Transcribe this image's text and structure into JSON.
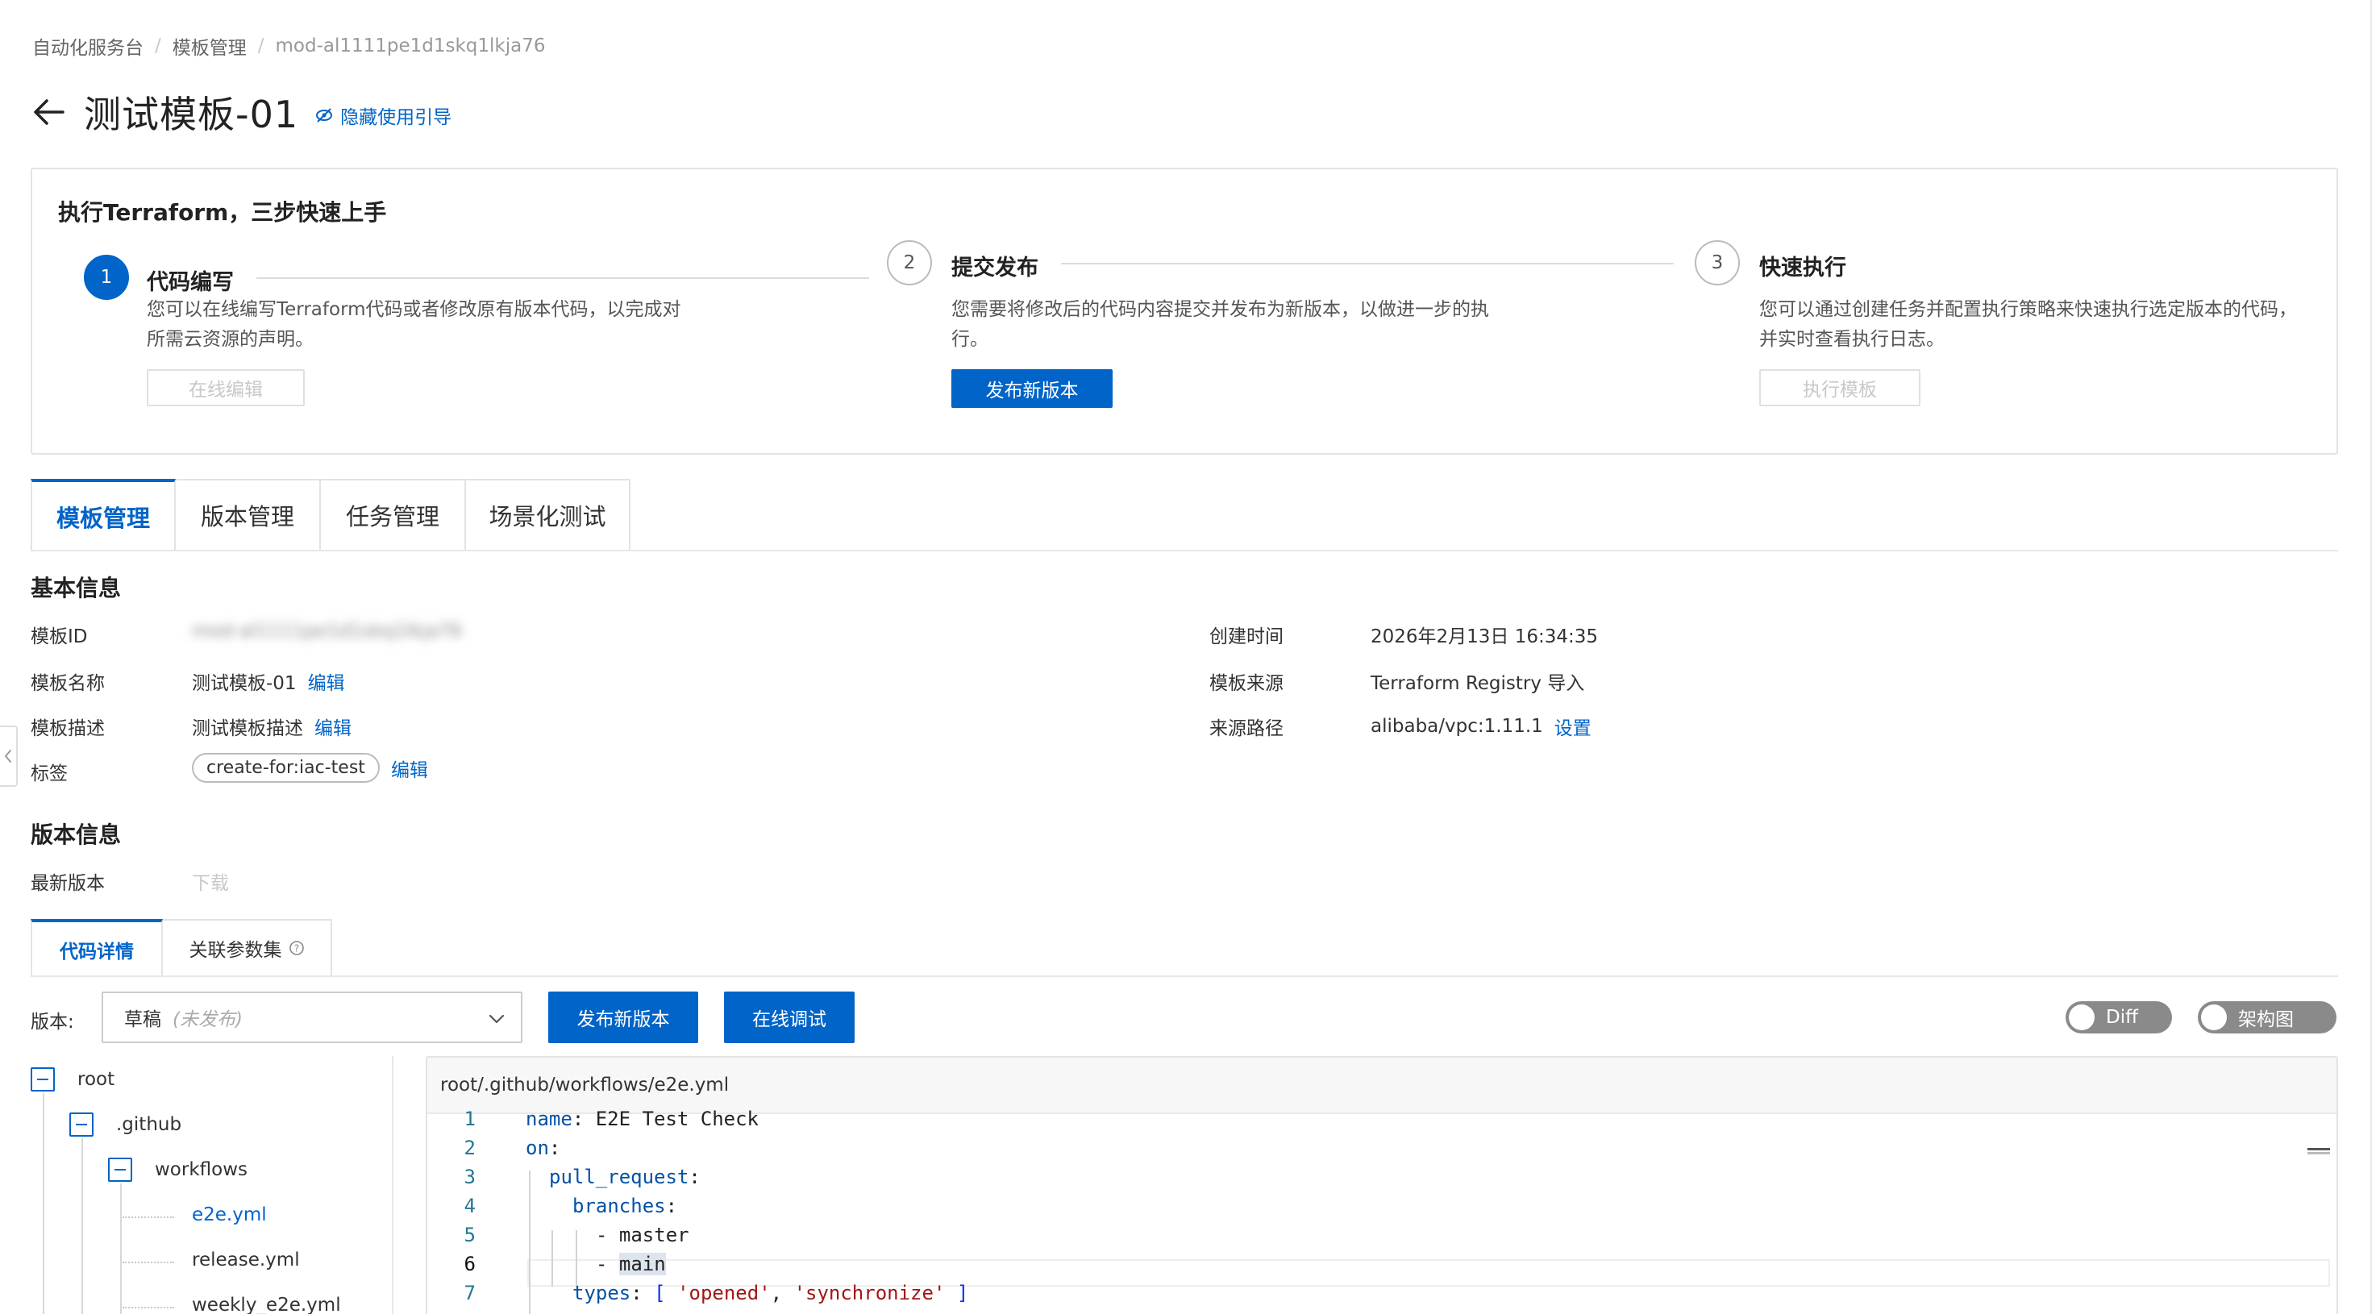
{
  "breadcrumb": {
    "items": [
      "自动化服务台",
      "模板管理",
      "mod-al1111pe1d1skq1lkja76"
    ],
    "separator": "/"
  },
  "header": {
    "title": "测试模板-01",
    "guide_link": "隐藏使用引导"
  },
  "guide": {
    "heading": "执行Terraform，三步快速上手",
    "steps": [
      {
        "number": "1",
        "title": "代码编写",
        "desc": "您可以在线编写Terraform代码或者修改原有版本代码，以完成对所需云资源的声明。",
        "button": "在线编辑"
      },
      {
        "number": "2",
        "title": "提交发布",
        "desc": "您需要将修改后的代码内容提交并发布为新版本，以做进一步的执行。",
        "button": "发布新版本"
      },
      {
        "number": "3",
        "title": "快速执行",
        "desc": "您可以通过创建任务并配置执行策略来快速执行选定版本的代码，并实时查看执行日志。",
        "button": "执行模板"
      }
    ]
  },
  "tabs": [
    "模板管理",
    "版本管理",
    "任务管理",
    "场景化测试"
  ],
  "basic_info": {
    "title": "基本信息",
    "template_id_label": "模板ID",
    "template_id_value": "mod-al1111pe1d1skq1lkja76",
    "name_label": "模板名称",
    "name_value": "测试模板-01",
    "desc_label": "模板描述",
    "desc_value": "测试模板描述",
    "tags_label": "标签",
    "tag_value": "create-for:iac-test",
    "edit": "编辑",
    "created_label": "创建时间",
    "created_value": "2026年2月13日 16:34:35",
    "source_label": "模板来源",
    "source_value": "Terraform Registry 导入",
    "path_label": "来源路径",
    "path_value": "alibaba/vpc:1.11.1",
    "set": "设置"
  },
  "version_info": {
    "title": "版本信息",
    "latest_label": "最新版本",
    "download": "下载"
  },
  "code_tabs": [
    "代码详情",
    "关联参数集"
  ],
  "toolbar": {
    "version_label": "版本:",
    "version_value": "草稿",
    "version_status": "(未发布)",
    "publish": "发布新版本",
    "debug": "在线调试",
    "diff_toggle": "Diff",
    "arch_toggle": "架构图"
  },
  "file_tree": {
    "root": "root",
    "github": ".github",
    "workflows": "workflows",
    "files": [
      "e2e.yml",
      "release.yml",
      "weekly_e2e.yml"
    ]
  },
  "editor": {
    "path": "root/.github/workflows/e2e.yml",
    "line_numbers": [
      "1",
      "2",
      "3",
      "4",
      "5",
      "6",
      "7"
    ],
    "current_line": 6,
    "lines": {
      "l1_key": "name",
      "l1_value": "E2E Test Check",
      "l2_key": "on",
      "l3_key": "pull_request",
      "l4_key": "branches",
      "l5_value": "master",
      "l6_value": "main",
      "l7_key": "types",
      "l7_v1": "'opened'",
      "l7_v2": "'synchronize'"
    }
  },
  "colors": {
    "primary": "#0064c8",
    "border": "#e3e3e3",
    "toggle_off": "#8a8a8a"
  },
  "icons": [
    "back-arrow-icon",
    "eye-off-icon",
    "chevron-down-icon",
    "help-icon",
    "collapse-icon",
    "chevron-left-icon"
  ]
}
